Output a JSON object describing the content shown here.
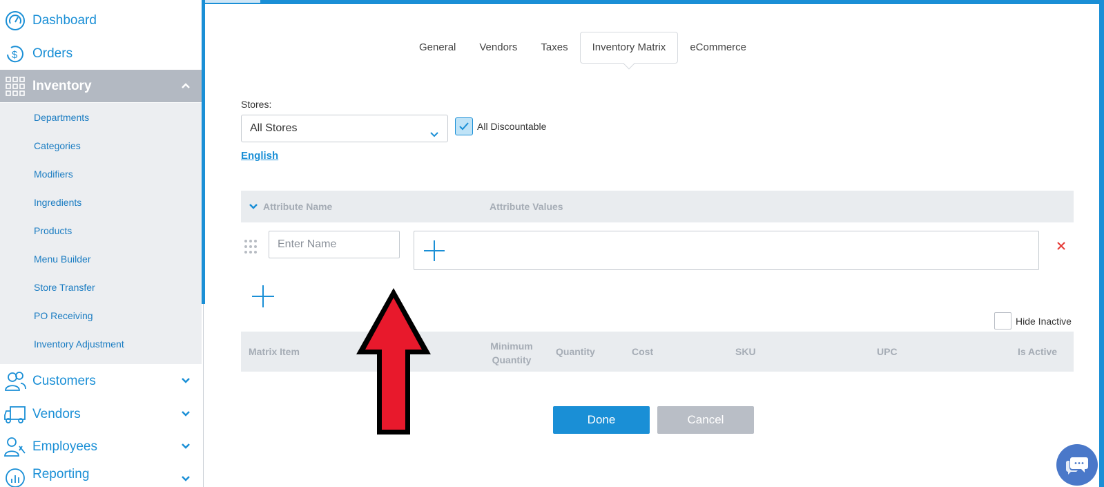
{
  "sidebar": {
    "items": [
      {
        "label": "Dashboard",
        "icon": "dashboard-gauge-icon"
      },
      {
        "label": "Orders",
        "icon": "orders-dollar-icon"
      },
      {
        "label": "Inventory",
        "icon": "inventory-grid-icon",
        "active": true
      },
      {
        "label": "Customers",
        "icon": "customers-people-icon"
      },
      {
        "label": "Vendors",
        "icon": "vendors-truck-icon"
      },
      {
        "label": "Employees",
        "icon": "employees-icon"
      },
      {
        "label": "Reporting",
        "icon": "reporting-chart-icon"
      }
    ],
    "inventory_submenu": [
      "Departments",
      "Categories",
      "Modifiers",
      "Ingredients",
      "Products",
      "Menu Builder",
      "Store Transfer",
      "PO Receiving",
      "Inventory Adjustment"
    ]
  },
  "tabs": [
    "General",
    "Vendors",
    "Taxes",
    "Inventory Matrix",
    "eCommerce"
  ],
  "active_tab": "Inventory Matrix",
  "stores": {
    "label": "Stores:",
    "selected": "All Stores"
  },
  "all_discountable": {
    "label": "All Discountable",
    "checked": true
  },
  "language_link": "English",
  "attributes": {
    "header_name": "Attribute Name",
    "header_values": "Attribute Values",
    "name_placeholder": "Enter Name"
  },
  "hide_inactive": {
    "label": "Hide Inactive",
    "checked": false
  },
  "matrix": {
    "headers": [
      "Matrix Item",
      "Minimum Quantity",
      "Quantity",
      "Cost",
      "SKU",
      "UPC",
      "Is Active"
    ]
  },
  "buttons": {
    "done": "Done",
    "cancel": "Cancel"
  },
  "colors": {
    "accent": "#1a8fd6",
    "active_nav": "#b3b9c2",
    "remove": "#e53935",
    "annotation_arrow": "#e8192c"
  }
}
